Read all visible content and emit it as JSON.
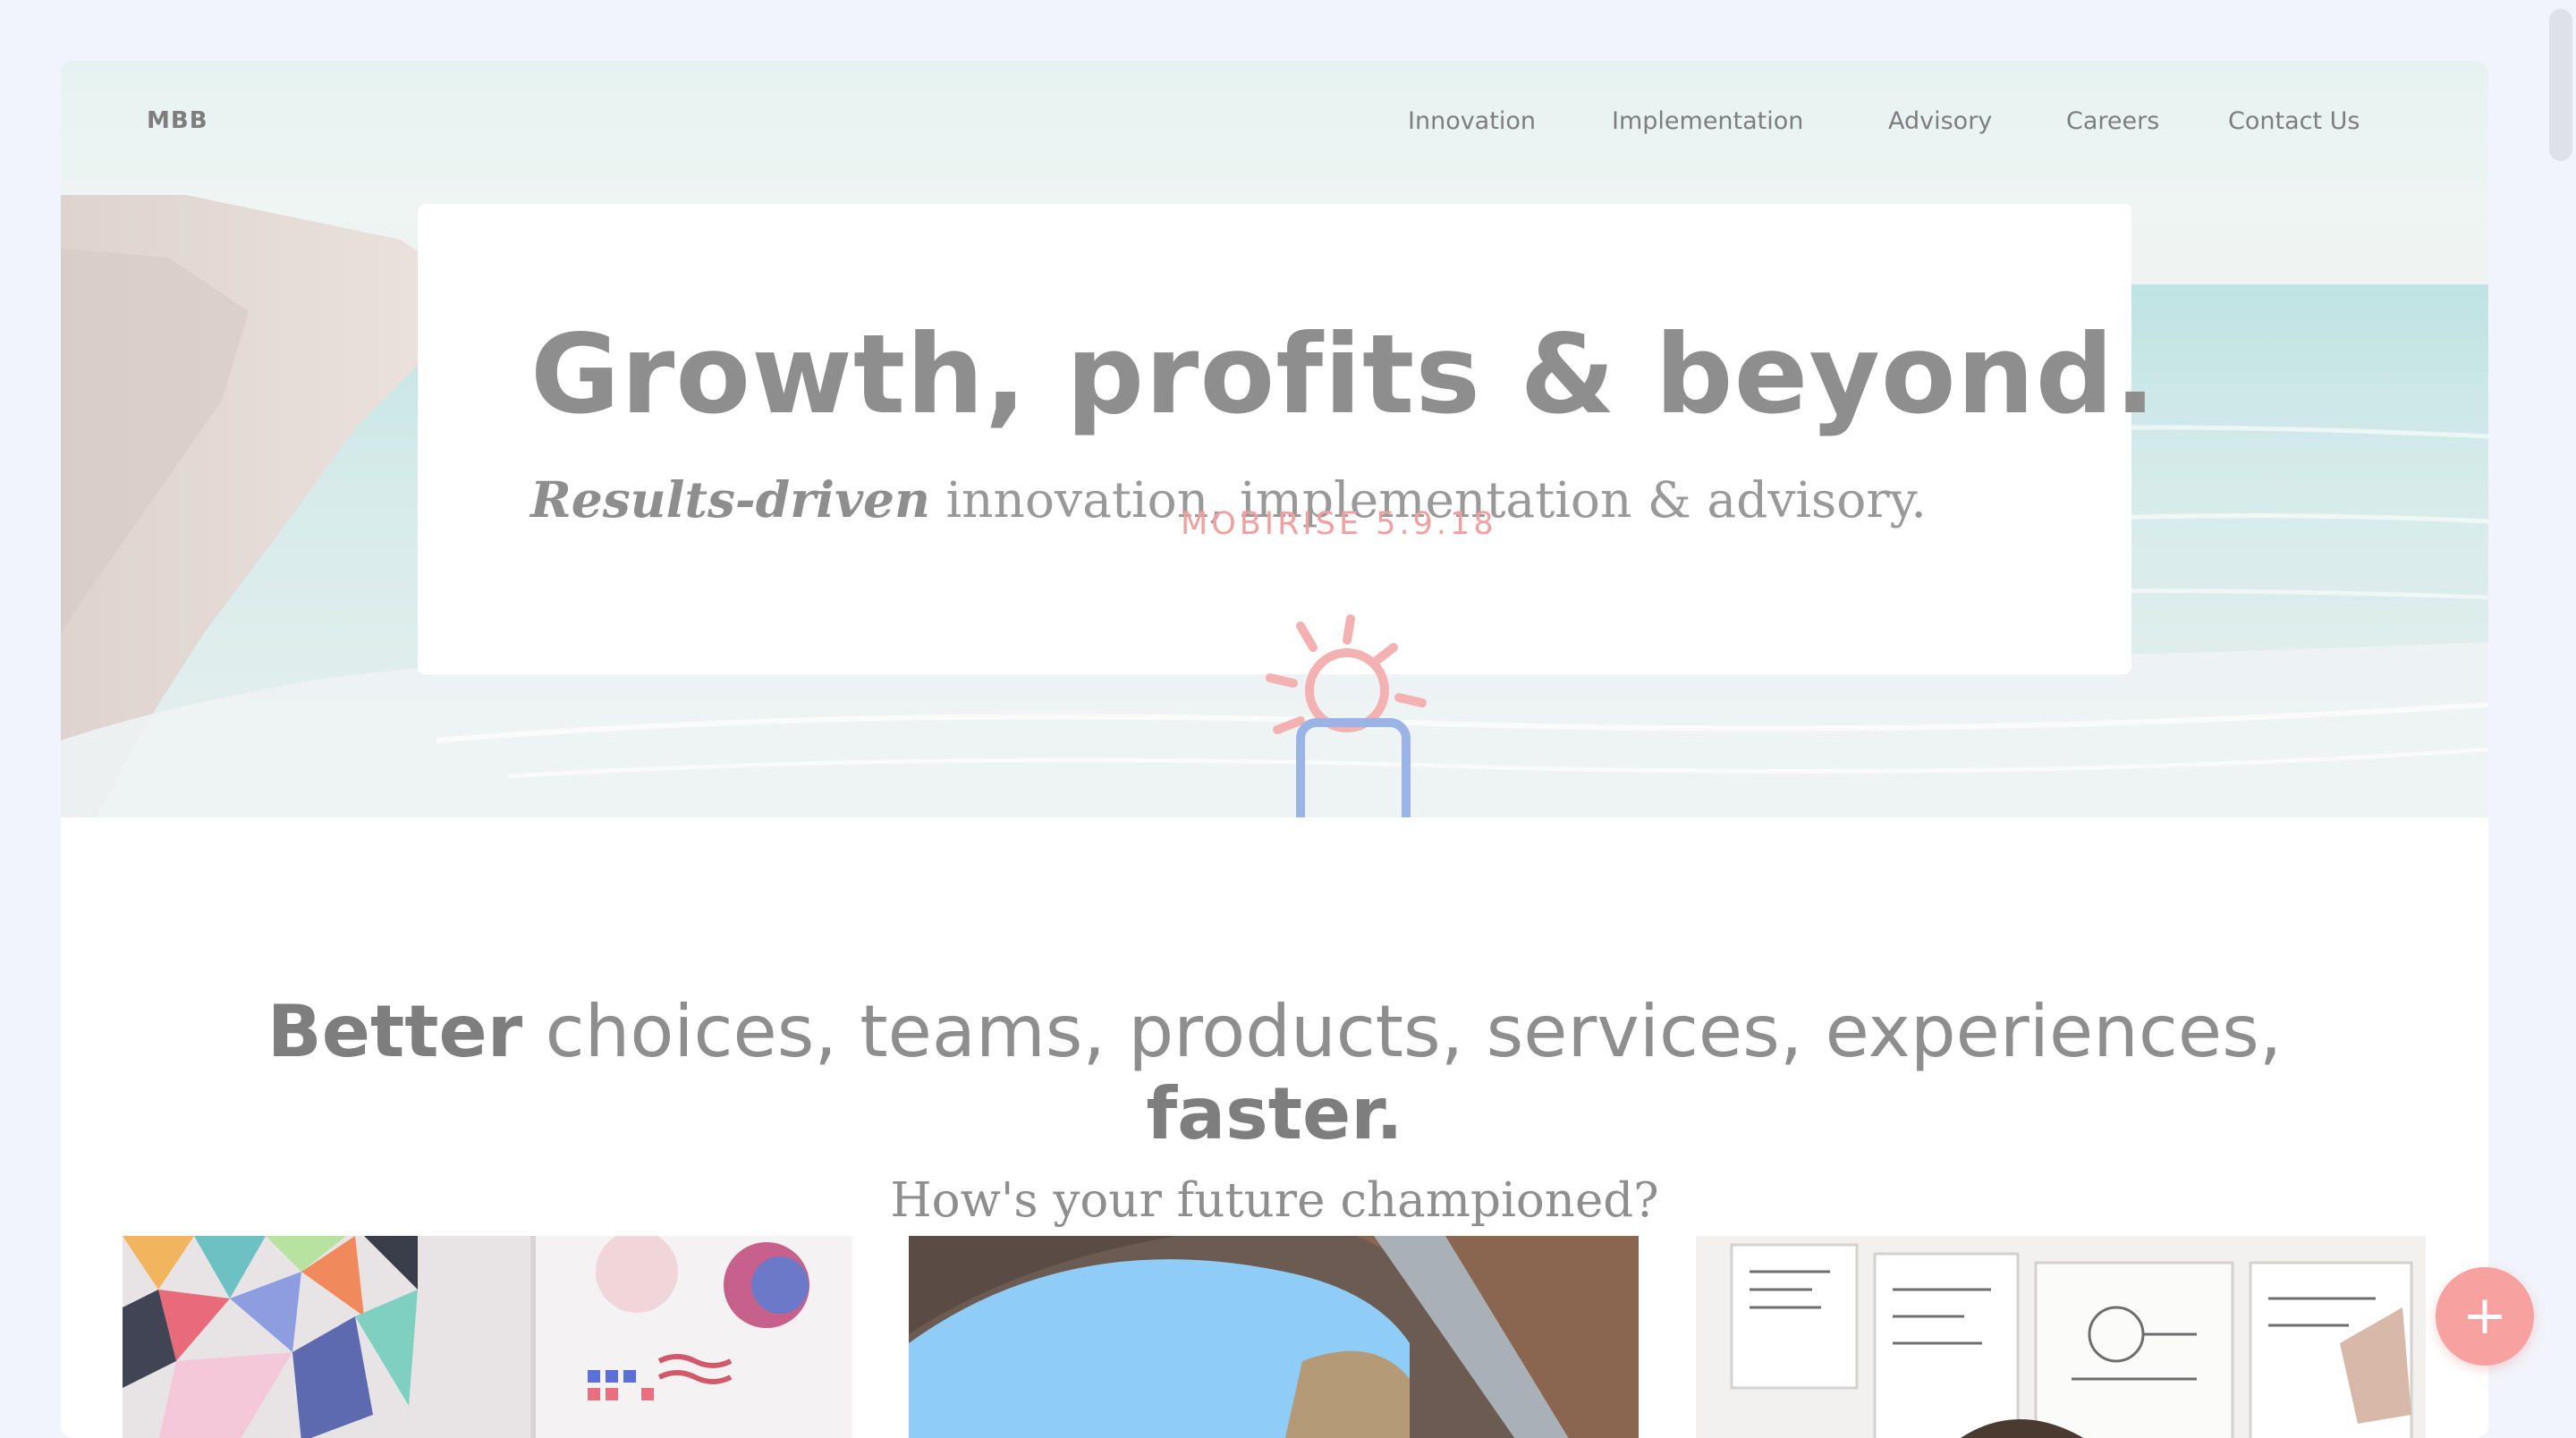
{
  "brand": "MBB",
  "nav": {
    "items": [
      {
        "label": "Innovation"
      },
      {
        "label": "Implementation"
      },
      {
        "label": "Advisory"
      },
      {
        "label": "Careers"
      },
      {
        "label": "Contact Us"
      }
    ]
  },
  "hero": {
    "title": "Growth, profits & beyond.",
    "subtitle_em": "Results-driven",
    "subtitle_rest": " innovation, implementation & advisory."
  },
  "watermark": "MOBIRISE  5.9.18",
  "section": {
    "title_bold_1": "Better",
    "title_rest": " choices, teams, products, services, experiences,",
    "title_bold_2": "faster.",
    "subtitle": "How's your future championed?"
  },
  "fab": {
    "label": "+"
  },
  "colors": {
    "accent": "#f7a1a1",
    "logo_phone": "#9bb4e8",
    "page_bg": "#f1f4fb"
  }
}
